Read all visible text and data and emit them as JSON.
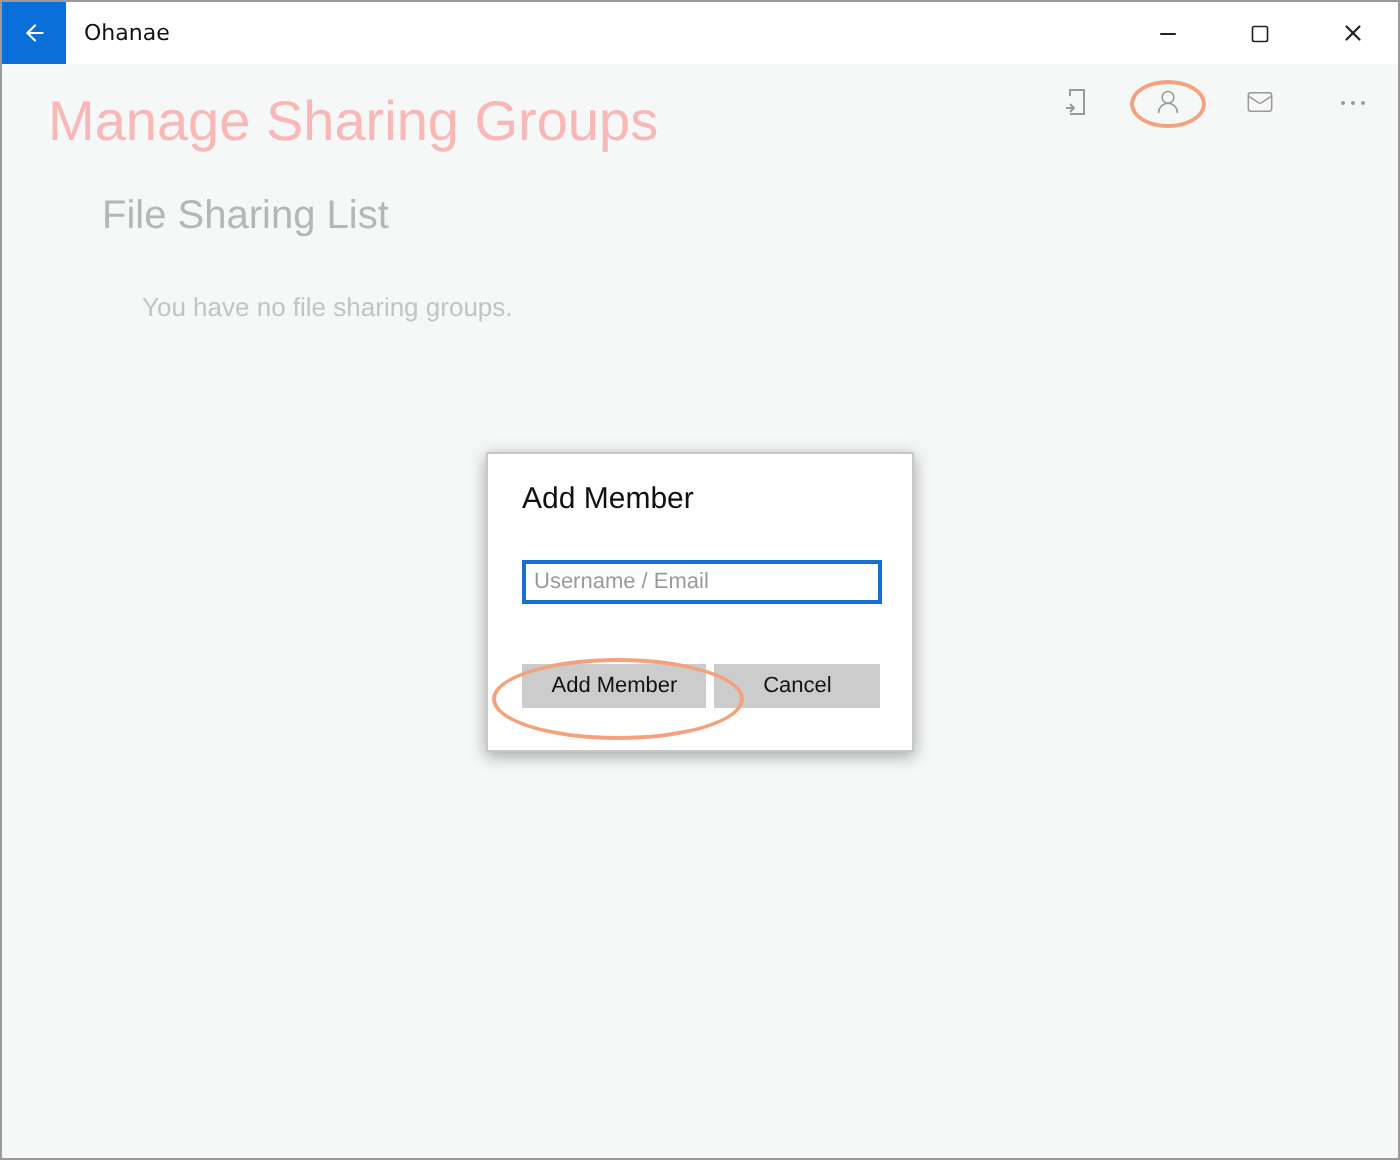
{
  "window": {
    "title": "Ohanae"
  },
  "toolbar": [
    {
      "kind": "device",
      "highlighted": false
    },
    {
      "kind": "person",
      "highlighted": true
    },
    {
      "kind": "mail",
      "highlighted": false
    },
    {
      "kind": "more",
      "highlighted": false
    }
  ],
  "page": {
    "title": "Manage Sharing Groups",
    "subtitle": "File Sharing List",
    "empty_message": "You have no file sharing groups."
  },
  "dialog": {
    "title": "Add Member",
    "field": {
      "placeholder": "Username / Email"
    },
    "buttons": [
      {
        "label": "Add Member",
        "highlighted": true
      },
      {
        "label": "Cancel",
        "highlighted": false
      }
    ]
  }
}
